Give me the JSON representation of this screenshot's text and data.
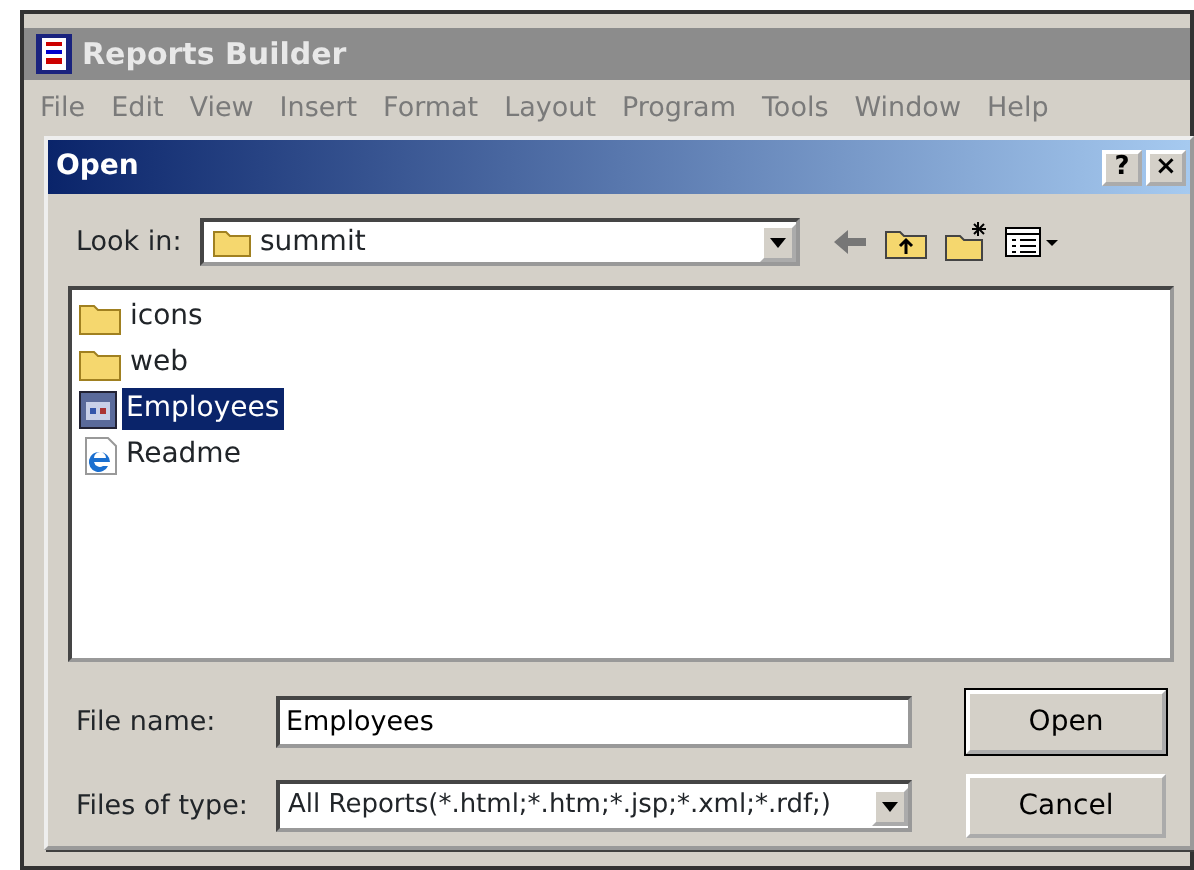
{
  "app_window": {
    "title": "Reports Builder",
    "menu": [
      "File",
      "Edit",
      "View",
      "Insert",
      "Format",
      "Layout",
      "Program",
      "Tools",
      "Window",
      "Help"
    ]
  },
  "dialog": {
    "title": "Open",
    "title_buttons": [
      "?",
      "×"
    ],
    "look_in": {
      "label": "Look in:",
      "value": "summit"
    },
    "files": [
      {
        "name": "icons",
        "kind": "folder",
        "selected": false
      },
      {
        "name": "web",
        "kind": "folder",
        "selected": false
      },
      {
        "name": "Employees",
        "kind": "report",
        "selected": true
      },
      {
        "name": "Readme",
        "kind": "html",
        "selected": false
      }
    ],
    "file_name": {
      "label": "File name:",
      "value": "Employees"
    },
    "file_type": {
      "label": "Files of type:",
      "value": "All Reports(*.html;*.htm;*.jsp;*.xml;*.rdf;)"
    },
    "buttons": [
      "Open",
      "Cancel"
    ]
  }
}
